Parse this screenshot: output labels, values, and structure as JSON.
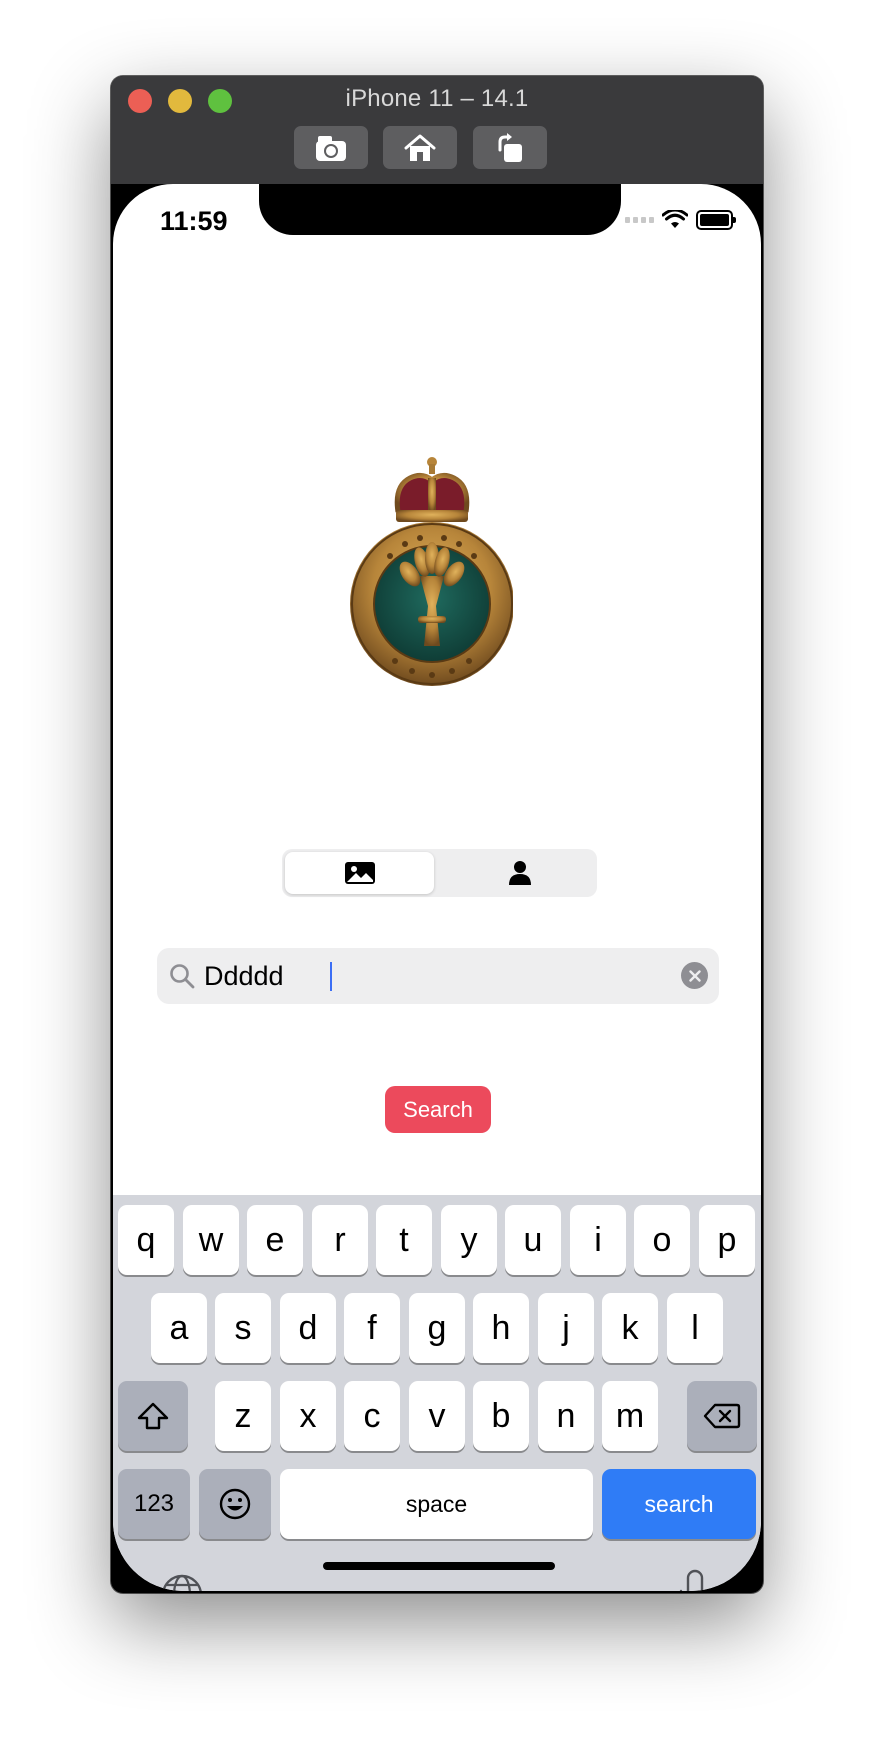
{
  "window": {
    "title": "iPhone 11 – 14.1"
  },
  "toolbar": {
    "buttons": [
      {
        "icon": "camera-icon"
      },
      {
        "icon": "home-icon"
      },
      {
        "icon": "rotate-icon"
      }
    ]
  },
  "status_bar": {
    "time": "11:59"
  },
  "badge": {
    "description_icon": "badge-image"
  },
  "segmented_control": {
    "segments": [
      {
        "icon": "photo-icon",
        "selected": true
      },
      {
        "icon": "person-icon",
        "selected": false
      }
    ]
  },
  "search": {
    "value": "Ddddd",
    "placeholder": ""
  },
  "search_button": {
    "label": "Search"
  },
  "keyboard": {
    "row1": [
      "q",
      "w",
      "e",
      "r",
      "t",
      "y",
      "u",
      "i",
      "o",
      "p"
    ],
    "row2": [
      "a",
      "s",
      "d",
      "f",
      "g",
      "h",
      "j",
      "k",
      "l"
    ],
    "row3": [
      "z",
      "x",
      "c",
      "v",
      "b",
      "n",
      "m"
    ],
    "numbers_label": "123",
    "space_label": "space",
    "return_label": "search"
  },
  "colors": {
    "accent_red": "#ec4a5c",
    "keyboard_blue": "#2f7cf6",
    "titlebar": "#3a3a3c"
  }
}
